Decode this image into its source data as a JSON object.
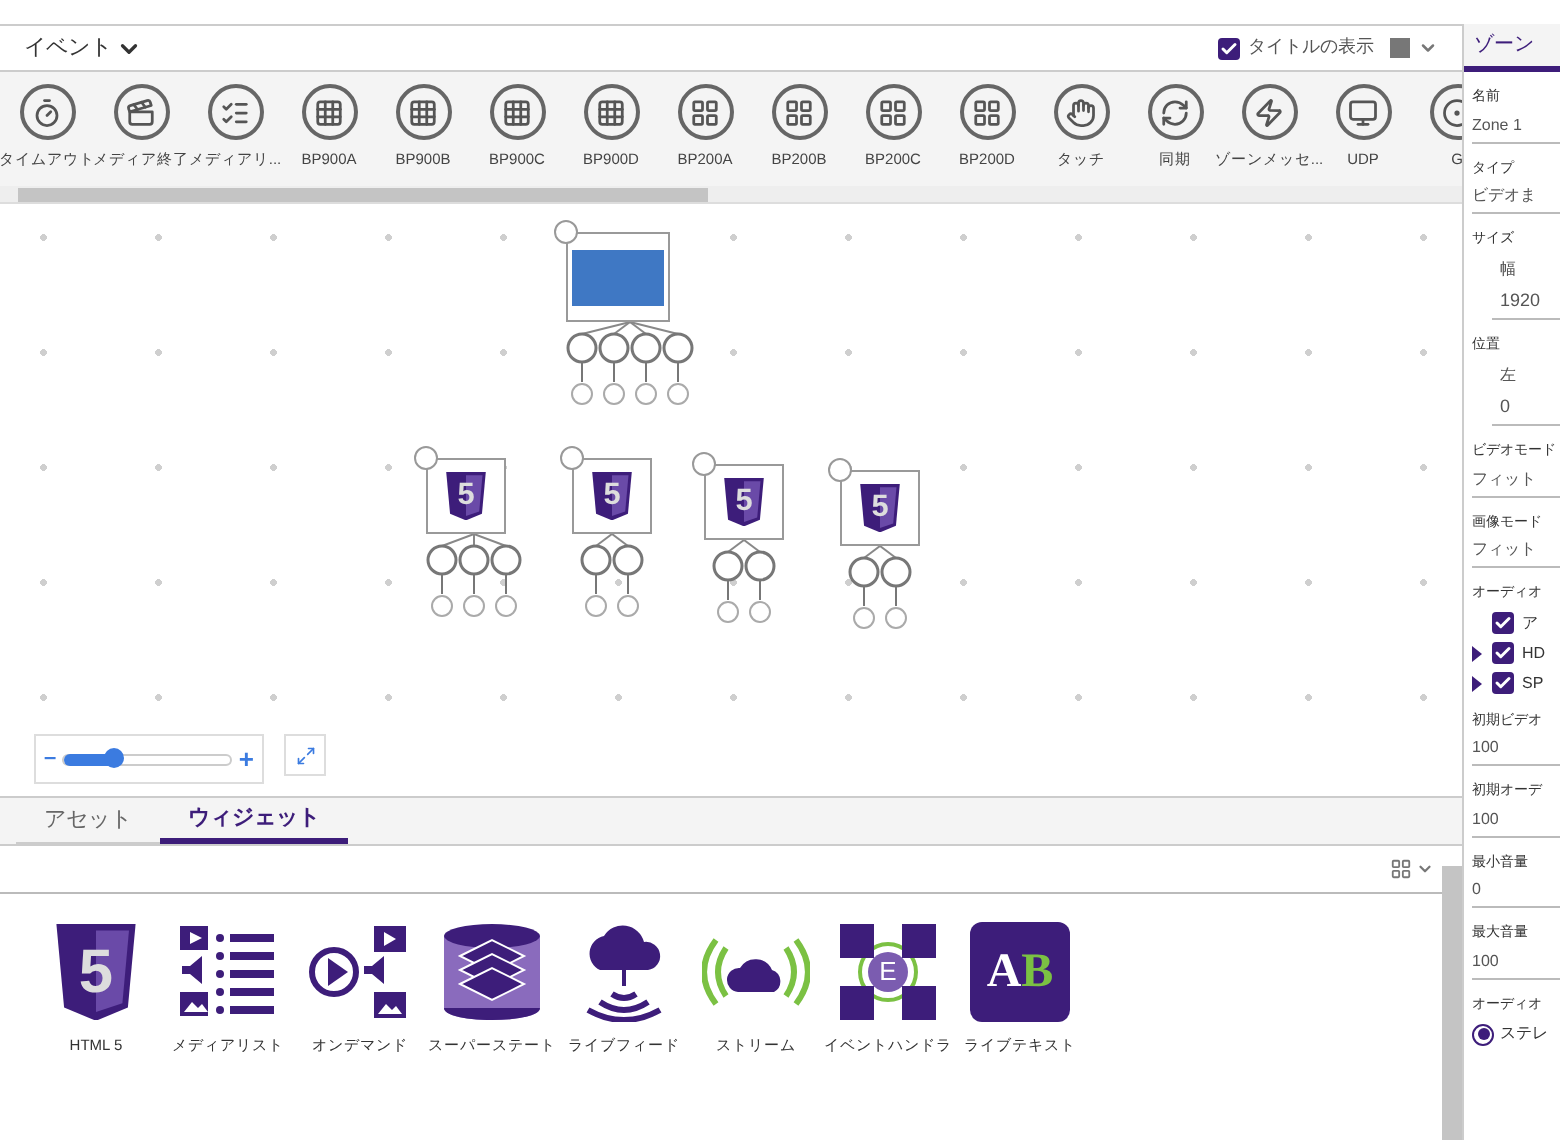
{
  "events_bar": {
    "title": "イベント",
    "show_title": {
      "label": "タイトルの表示",
      "checked": true
    }
  },
  "toolbar": [
    {
      "label": "タイムアウト",
      "kind": "timer"
    },
    {
      "label": "メディア終了",
      "kind": "clapper"
    },
    {
      "label": "メディアリ...",
      "kind": "list"
    },
    {
      "label": "BP900A",
      "kind": "keypad"
    },
    {
      "label": "BP900B",
      "kind": "keypad"
    },
    {
      "label": "BP900C",
      "kind": "keypad"
    },
    {
      "label": "BP900D",
      "kind": "keypad"
    },
    {
      "label": "BP200A",
      "kind": "keypad2"
    },
    {
      "label": "BP200B",
      "kind": "keypad2"
    },
    {
      "label": "BP200C",
      "kind": "keypad2"
    },
    {
      "label": "BP200D",
      "kind": "keypad2"
    },
    {
      "label": "タッチ",
      "kind": "touch"
    },
    {
      "label": "同期",
      "kind": "sync"
    },
    {
      "label": "ゾーンメッセ...",
      "kind": "bolt"
    },
    {
      "label": "UDP",
      "kind": "network"
    },
    {
      "label": "G",
      "kind": "gpio"
    }
  ],
  "canvas": {
    "nodes": [
      {
        "kind": "image"
      },
      {
        "kind": "html5",
        "badge": "5"
      },
      {
        "kind": "html5",
        "badge": "5"
      },
      {
        "kind": "html5",
        "badge": "5"
      },
      {
        "kind": "html5",
        "badge": "5"
      }
    ],
    "zoom": {
      "level": 0.3,
      "minus": "–",
      "plus": "+"
    }
  },
  "tabs": [
    {
      "label": "アセット",
      "selected": false
    },
    {
      "label": "ウィジェット",
      "selected": true
    }
  ],
  "widgets": [
    {
      "label": "HTML 5",
      "kind": "html5",
      "glyphs": [
        "5"
      ]
    },
    {
      "label": "メディアリスト",
      "kind": "medialist"
    },
    {
      "label": "オンデマンド",
      "kind": "ondemand"
    },
    {
      "label": "スーパーステート",
      "kind": "superstate"
    },
    {
      "label": "ライブフィード",
      "kind": "livefeed"
    },
    {
      "label": "ストリーム",
      "kind": "stream"
    },
    {
      "label": "イベントハンドラ",
      "kind": "eventhandler",
      "glyphs": [
        "E"
      ]
    },
    {
      "label": "ライブテキスト",
      "kind": "livetext",
      "glyphs": [
        "A",
        "B"
      ]
    }
  ],
  "panel": {
    "tab": "ゾーン",
    "sections": [
      {
        "kind": "field",
        "label": "名前",
        "value": "Zone 1"
      },
      {
        "kind": "field",
        "label": "タイプ",
        "value": "ビデオま"
      },
      {
        "kind": "sub",
        "label": "サイズ",
        "sublabel": "幅",
        "value": "1920"
      },
      {
        "kind": "sub",
        "label": "位置",
        "sublabel": "左",
        "value": "0"
      },
      {
        "kind": "field",
        "label": "ビデオモード",
        "value": "フィット"
      },
      {
        "kind": "field",
        "label": "画像モード",
        "value": "フィット"
      },
      {
        "kind": "checks",
        "label": "オーディオ",
        "items": [
          {
            "label": "ア",
            "checked": true,
            "expandable": false
          },
          {
            "label": "HD",
            "checked": true,
            "expandable": true
          },
          {
            "label": "SP",
            "checked": true,
            "expandable": true
          }
        ]
      },
      {
        "kind": "field",
        "label": "初期ビデオ",
        "value": "100"
      },
      {
        "kind": "field",
        "label": "初期オーデ",
        "value": "100"
      },
      {
        "kind": "field",
        "label": "最小音量",
        "value": "0"
      },
      {
        "kind": "field",
        "label": "最大音量",
        "value": "100"
      },
      {
        "kind": "radios",
        "label": "オーディオ",
        "items": [
          {
            "label": "ステレ",
            "selected": true
          }
        ]
      }
    ]
  }
}
